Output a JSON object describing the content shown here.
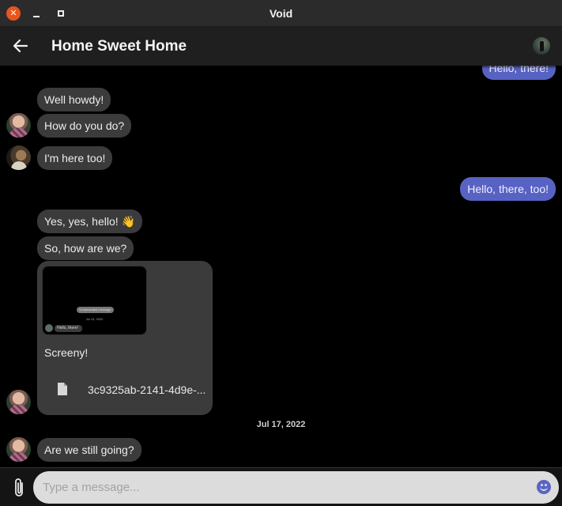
{
  "window": {
    "title": "Void",
    "close_glyph": "✕"
  },
  "appbar": {
    "title": "Home Sweet Home",
    "back_icon": "arrow-left-icon"
  },
  "messages": [
    {
      "text": "Hello, there!",
      "side": "out"
    },
    {
      "text": "Well howdy!",
      "side": "in"
    },
    {
      "text": "How do you do?",
      "side": "in"
    },
    {
      "text": "I'm here too!",
      "side": "in"
    },
    {
      "text": "Hello, there, too!",
      "side": "out"
    },
    {
      "text": "Yes, yes, hello! 👋",
      "side": "in"
    },
    {
      "text": "So, how are we?",
      "side": "in"
    },
    {
      "text": "Are we still going?",
      "side": "in"
    }
  ],
  "attachment": {
    "caption": "Screeny!",
    "file_name": "3c9325ab-2141-4d9e-...",
    "thumbnail": {
      "pill": "Undecorated message",
      "date": "Jul 13, 2022",
      "message": "Hello, there!"
    }
  },
  "date_separator": "Jul 17, 2022",
  "composer": {
    "placeholder": "Type a message..."
  },
  "colors": {
    "outgoing": "#5762c3",
    "incoming": "#3b3b3b",
    "accent": "#5a64c4"
  }
}
